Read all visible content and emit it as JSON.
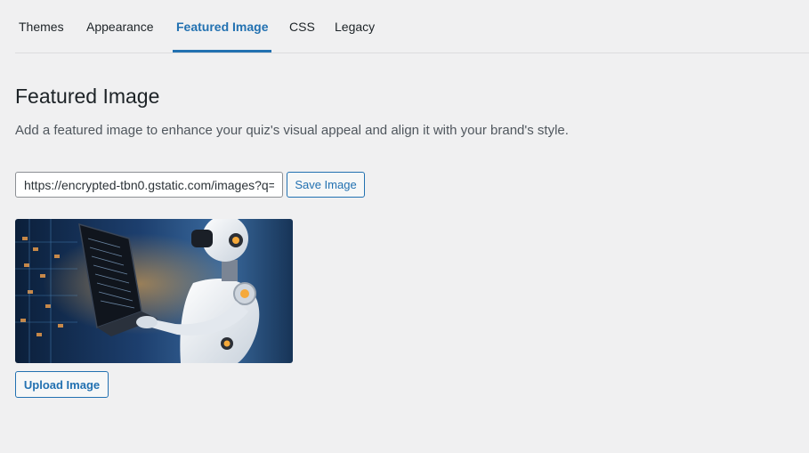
{
  "tabs": [
    {
      "label": "Themes",
      "active": false
    },
    {
      "label": "Appearance",
      "active": false
    },
    {
      "label": "Featured Image",
      "active": true
    },
    {
      "label": "CSS",
      "active": false
    },
    {
      "label": "Legacy",
      "active": false
    }
  ],
  "section": {
    "title": "Featured Image",
    "description": "Add a featured image to enhance your quiz's visual appeal and align it with your brand's style."
  },
  "image_url_input": {
    "value": "https://encrypted-tbn0.gstatic.com/images?q="
  },
  "buttons": {
    "save_label": "Save Image",
    "upload_label": "Upload Image"
  },
  "preview_image": {
    "subject": "robot-holding-laptop"
  },
  "colors": {
    "accent": "#2271b1",
    "background": "#f0f0f1",
    "text": "#1d2327",
    "muted_text": "#50575e"
  }
}
